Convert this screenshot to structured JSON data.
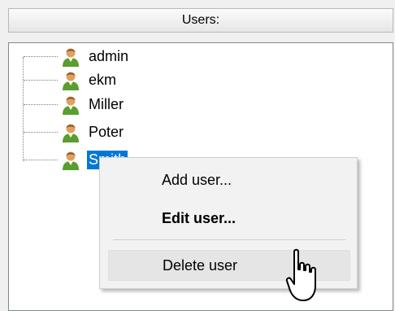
{
  "header": {
    "title": "Users:"
  },
  "users": [
    {
      "name": "admin",
      "selected": false
    },
    {
      "name": "ekm",
      "selected": false
    },
    {
      "name": "Miller",
      "selected": false
    },
    {
      "name": "Poter",
      "selected": false
    },
    {
      "name": "Smith",
      "selected": true
    }
  ],
  "context_menu": {
    "items": [
      {
        "label": "Add user...",
        "bold": false,
        "hovered": false
      },
      {
        "label": "Edit user...",
        "bold": true,
        "hovered": false
      },
      {
        "label": "Delete user",
        "bold": false,
        "hovered": true
      }
    ]
  },
  "icons": {
    "user": "user-icon",
    "cursor": "mouse-pointer-icon"
  },
  "colors": {
    "selection": "#0078d7",
    "icon_body": "#5a9e2e",
    "icon_head": "#e0a060"
  }
}
